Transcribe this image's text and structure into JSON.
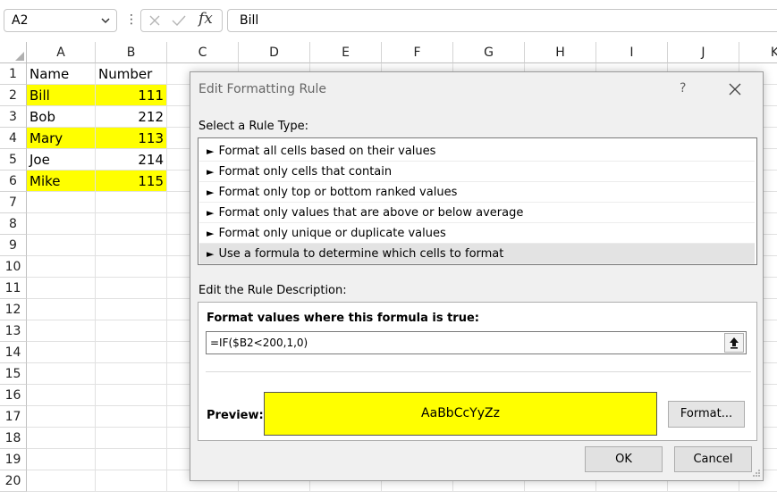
{
  "formula_bar": {
    "name_box": "A2",
    "fx_label": "fx",
    "content": "Bill"
  },
  "sheet": {
    "columns": [
      "A",
      "B",
      "C",
      "D",
      "E",
      "F",
      "G",
      "H",
      "I",
      "J",
      "K"
    ],
    "rows": [
      "1",
      "2",
      "3",
      "4",
      "5",
      "6",
      "7",
      "8",
      "9",
      "10",
      "11",
      "12",
      "13",
      "14",
      "15",
      "16",
      "17",
      "18",
      "19",
      "20"
    ],
    "data": [
      {
        "name": "Name",
        "number": "Number",
        "highlight": false
      },
      {
        "name": "Bill",
        "number": "111",
        "highlight": true
      },
      {
        "name": "Bob",
        "number": "212",
        "highlight": false
      },
      {
        "name": "Mary",
        "number": "113",
        "highlight": true
      },
      {
        "name": "Joe",
        "number": "214",
        "highlight": false
      },
      {
        "name": "Mike",
        "number": "115",
        "highlight": true
      }
    ],
    "highlight_color": "#ffff00"
  },
  "dialog": {
    "title": "Edit Formatting Rule",
    "help": "?",
    "select_rule_type_label": "Select a Rule Type:",
    "rule_types": [
      "Format all cells based on their values",
      "Format only cells that contain",
      "Format only top or bottom ranked values",
      "Format only values that are above or below average",
      "Format only unique or duplicate values",
      "Use a formula to determine which cells to format"
    ],
    "selected_rule_index": 5,
    "edit_description_label": "Edit the Rule Description:",
    "format_where_label": "Format values where this formula is true:",
    "formula": "=IF($B2<200,1,0)",
    "preview_label": "Preview:",
    "preview_text": "AaBbCcYyZz",
    "preview_color": "#ffff00",
    "format_button": "Format...",
    "ok_button": "OK",
    "cancel_button": "Cancel"
  }
}
